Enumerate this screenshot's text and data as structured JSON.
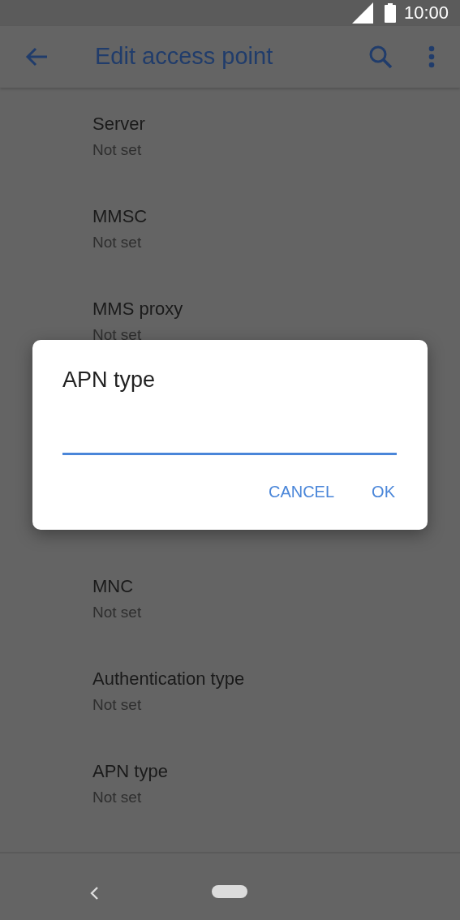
{
  "status_bar": {
    "time": "10:00"
  },
  "app_bar": {
    "title": "Edit access point"
  },
  "settings": [
    {
      "title": "Server",
      "summary": "Not set"
    },
    {
      "title": "MMSC",
      "summary": "Not set"
    },
    {
      "title": "MMS proxy",
      "summary": "Not set"
    }
  ],
  "settings_below": [
    {
      "title": "MNC",
      "summary": "Not set"
    },
    {
      "title": "Authentication type",
      "summary": "Not set"
    },
    {
      "title": "APN type",
      "summary": "Not set"
    }
  ],
  "dialog": {
    "title": "APN type",
    "buttons": [
      "CANCEL",
      "OK"
    ]
  }
}
